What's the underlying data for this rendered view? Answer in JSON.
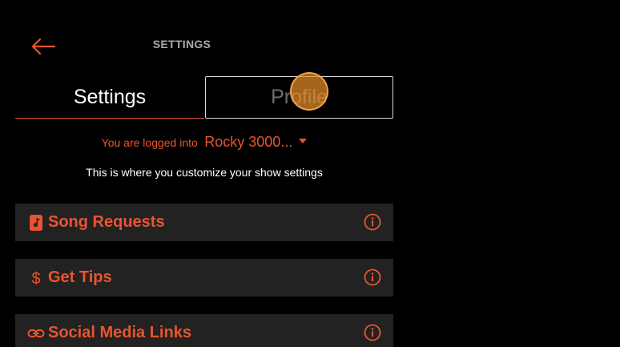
{
  "header": {
    "title": "SETTINGS",
    "back_icon": "arrow-left-icon"
  },
  "tabs": [
    {
      "label": "Settings",
      "active": true
    },
    {
      "label": "Profile",
      "active": false
    }
  ],
  "login": {
    "prefix": "You are logged into",
    "account": "Rocky 3000...",
    "dropdown_icon": "caret-down-icon"
  },
  "subtitle": "This is where you customize your show settings",
  "sections": [
    {
      "label": "Song Requests",
      "icon": "music-note-icon"
    },
    {
      "label": "Get Tips",
      "icon": "dollar-icon"
    },
    {
      "label": "Social Media Links",
      "icon": "link-icon"
    }
  ],
  "colors": {
    "accent": "#e9542f",
    "background": "#000000",
    "panel": "#222222",
    "text": "#ffffff",
    "muted": "#a9a9a9"
  }
}
